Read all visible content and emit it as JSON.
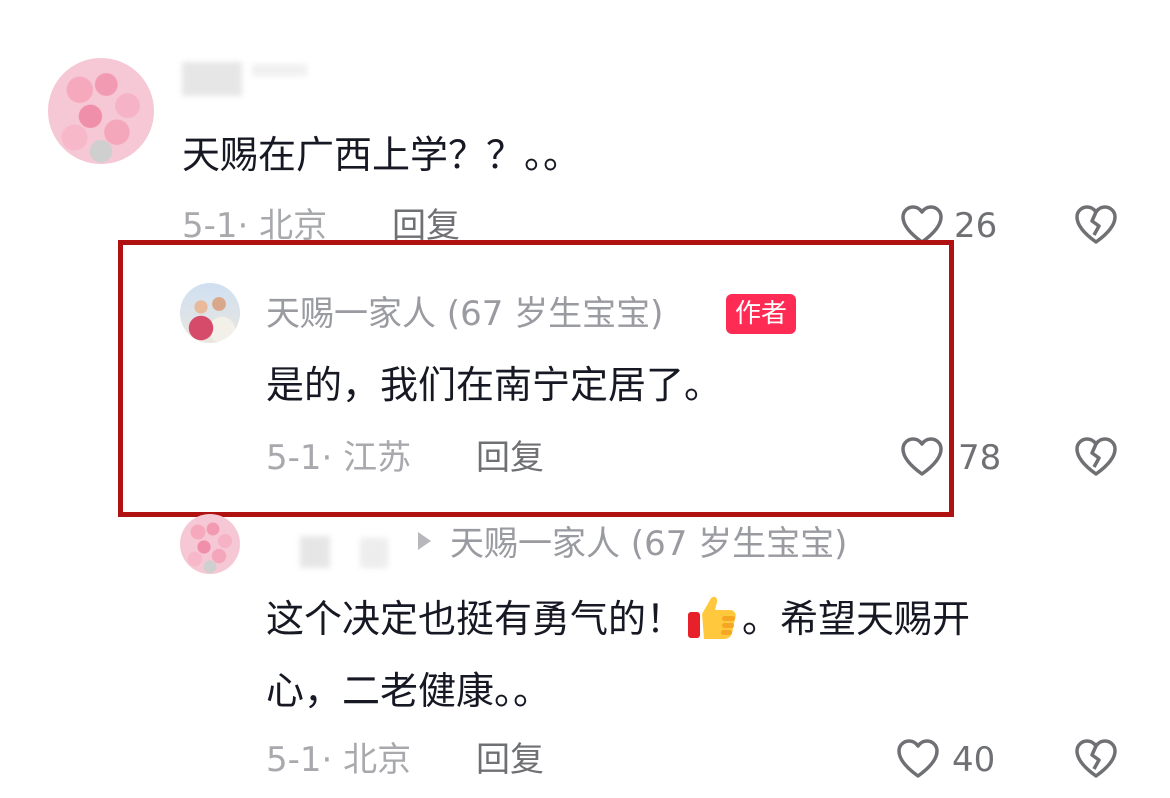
{
  "comments": [
    {
      "text": "天赐在广西上学？？。。",
      "meta": "5-1· 北京",
      "reply": "回复",
      "likes": "26"
    },
    {
      "username": "天赐一家人 (67 岁生宝宝)",
      "badge": "作者",
      "text": "是的，我们在南宁定居了。",
      "meta": "5-1· 江苏",
      "reply": "回复",
      "likes": "78"
    },
    {
      "reply_to": "天赐一家人 (67 岁生宝宝)",
      "text_line1_a": "这个决定也挺有勇气的！",
      "text_line1_b": "。希望天赐开",
      "text_line2": "心，二老健康。。",
      "meta": "5-1· 北京",
      "reply": "回复",
      "likes": "40"
    }
  ],
  "icons": {
    "like": "heart-outline-icon",
    "dislike": "broken-heart-icon",
    "reply_arrow": "triangle-right-icon",
    "emoji": "thumbs-up-emoji"
  },
  "colors": {
    "highlight_border": "#b01212",
    "badge_bg": "#fe2c55"
  }
}
